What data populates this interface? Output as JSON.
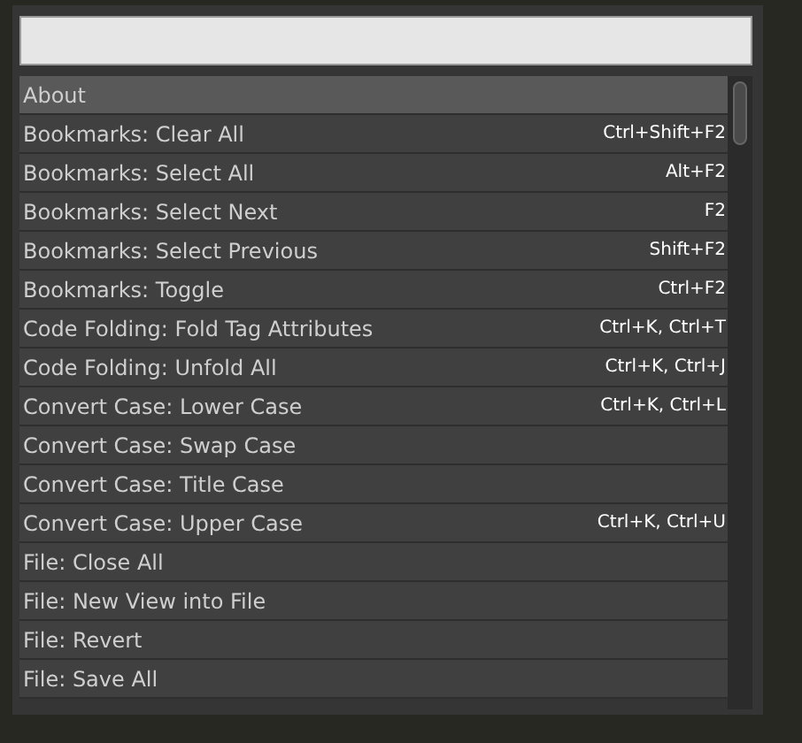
{
  "commands": [
    {
      "label": "About",
      "selected": true
    },
    {
      "label": "Bookmarks: Clear All",
      "shortcut": "Ctrl+Shift+F2",
      "selected": false
    },
    {
      "label": "Bookmarks: Select All",
      "shortcut": "Alt+F2",
      "selected": false
    },
    {
      "label": "Bookmarks: Select Next",
      "shortcut": "F2",
      "selected": false
    },
    {
      "label": "Bookmarks: Select Previous",
      "shortcut": "Shift+F2",
      "selected": false
    },
    {
      "label": "Bookmarks: Toggle",
      "shortcut": "Ctrl+F2",
      "selected": false
    },
    {
      "label": "Code Folding: Fold Tag Attributes",
      "shortcut": "Ctrl+K, Ctrl+T",
      "selected": false
    },
    {
      "label": "Code Folding: Unfold All",
      "shortcut": "Ctrl+K, Ctrl+J",
      "selected": false
    },
    {
      "label": "Convert Case: Lower Case",
      "shortcut": "Ctrl+K, Ctrl+L",
      "selected": false
    },
    {
      "label": "Convert Case: Swap Case",
      "selected": false
    },
    {
      "label": "Convert Case: Title Case",
      "selected": false
    },
    {
      "label": "Convert Case: Upper Case",
      "shortcut": "Ctrl+K, Ctrl+U",
      "selected": false
    },
    {
      "label": "File: Close All",
      "selected": false
    },
    {
      "label": "File: New View into File",
      "selected": false
    },
    {
      "label": "File: Revert",
      "selected": false
    },
    {
      "label": "File: Save All",
      "selected": false
    }
  ]
}
